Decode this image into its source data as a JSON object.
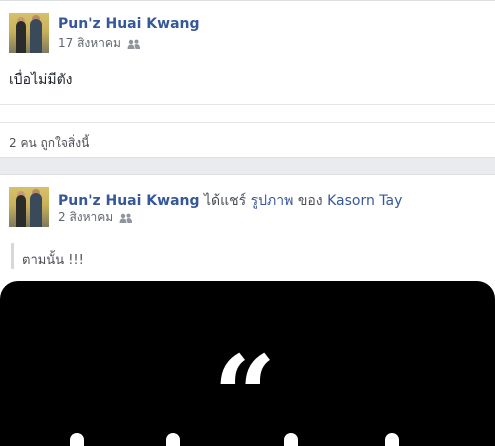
{
  "colors": {
    "link": "#365899",
    "text": "#1d2129",
    "meta": "#616770",
    "background": "#e9ebee"
  },
  "posts": [
    {
      "author": "Pun'z Huai Kwang",
      "date": "17 สิงหาคม",
      "audience_icon": "friends-icon",
      "text": "เบื่อไม่มีตัง",
      "likes": "2 คน ถูกใจสิ่งนี้"
    },
    {
      "author": "Pun'z Huai Kwang",
      "shared_text": "ได้แชร์",
      "shared_link": "รูปภาพ",
      "of_text": "ของ",
      "owner": "Kasorn Tay",
      "date": "2 สิงหาคม",
      "audience_icon": "friends-icon",
      "quote": "ตามนั้น !!!",
      "photo_glyph": "“"
    }
  ]
}
